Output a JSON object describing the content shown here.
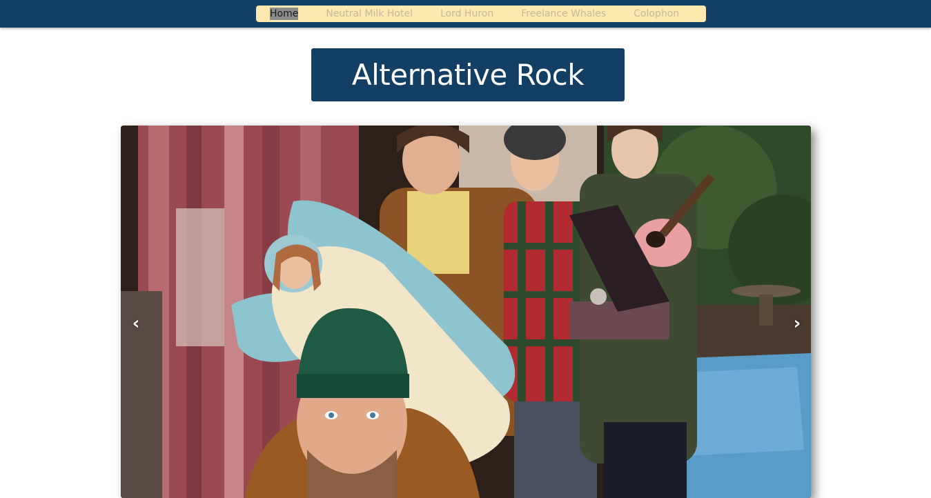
{
  "nav": {
    "items": [
      {
        "label": "Home",
        "active": true
      },
      {
        "label": "Neutral Milk Hotel",
        "active": false
      },
      {
        "label": "Lord Huron",
        "active": false
      },
      {
        "label": "Freelance Whales",
        "active": false
      },
      {
        "label": "Colophon",
        "active": false
      }
    ]
  },
  "page": {
    "title": "Alternative Rock"
  },
  "carousel": {
    "prev_glyph": "‹",
    "next_glyph": "›"
  },
  "colors": {
    "header_bg": "#123f63",
    "nav_bg": "#fde8b0",
    "nav_text": "#c9b99a",
    "title_bg": "#123f63",
    "title_text": "#ffffff"
  }
}
